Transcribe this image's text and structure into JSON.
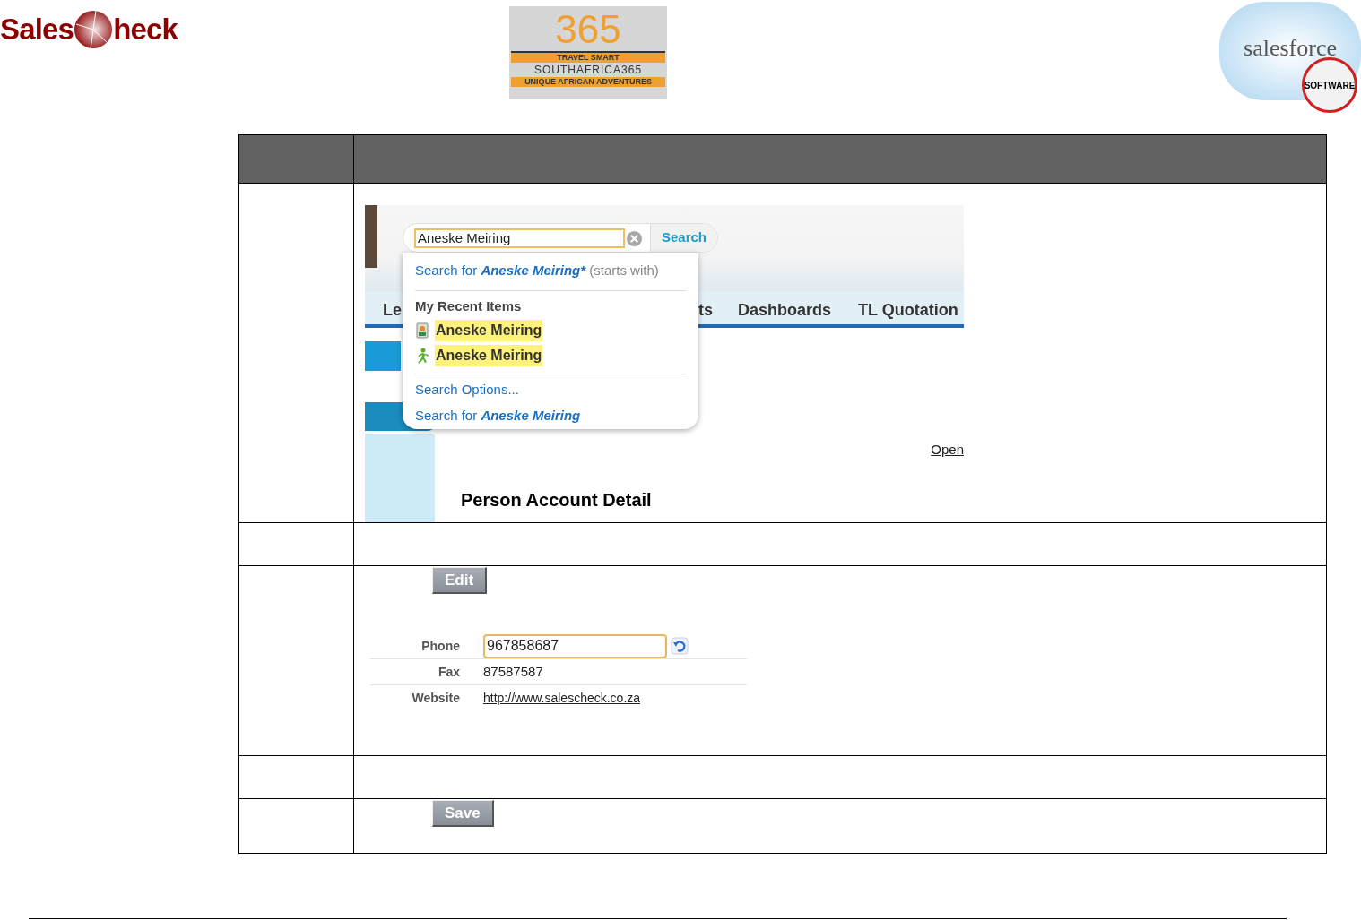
{
  "logos": {
    "salescheck": {
      "left": "Sales",
      "right": "heck"
    },
    "southafrica365": {
      "number": "365",
      "tagline": "TRAVEL SMART",
      "name": "SOUTHAFRICA365",
      "slogan": "UNIQUE AFRICAN ADVENTURES"
    },
    "salesforce": {
      "name": "salesforce",
      "badge": "SOFTWARE"
    }
  },
  "table": {
    "rows": [
      {
        "kind": "search_screenshot",
        "search": {
          "value": "Aneske Meiring",
          "button": "Search"
        },
        "tabs": [
          "Le",
          "ts",
          "Dashboards",
          "TL Quotation"
        ],
        "dropdown": {
          "search_starts": {
            "prefix": "Search for",
            "query": "Aneske Meiring*",
            "suffix": "(starts with)"
          },
          "recent_title": "My Recent Items",
          "recent": [
            {
              "kind": "contact",
              "label": "Aneske Meiring"
            },
            {
              "kind": "person",
              "label": "Aneske Meiring"
            }
          ],
          "options": "Search Options...",
          "search_all": {
            "prefix": "Search for",
            "query": "Aneske Meiring"
          }
        },
        "open_link": "Open",
        "section_title": "Person Account Detail"
      },
      {
        "kind": "empty"
      },
      {
        "kind": "edit_screenshot",
        "button": "Edit",
        "fields": [
          {
            "kind": "input",
            "label": "Phone",
            "value": "967858687"
          },
          {
            "kind": "text",
            "label": "Fax",
            "value": "87587587"
          },
          {
            "kind": "link",
            "label": "Website",
            "value": "http://www.salescheck.co.za"
          }
        ]
      },
      {
        "kind": "empty"
      },
      {
        "kind": "save_screenshot",
        "button": "Save"
      }
    ]
  }
}
